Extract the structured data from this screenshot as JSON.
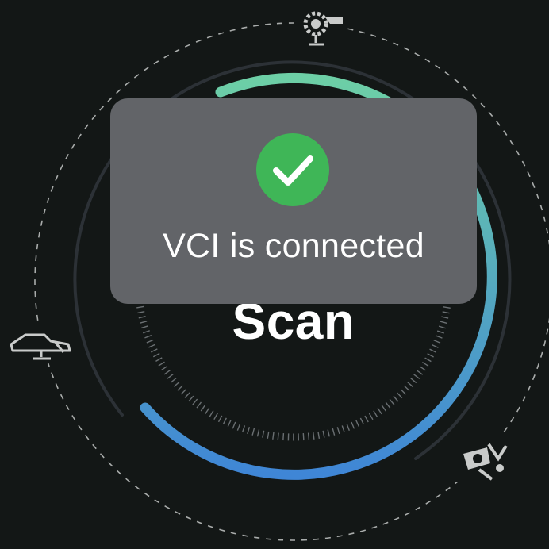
{
  "screen": {
    "background_color": "#131716"
  },
  "dial": {
    "scan_label": "Scan",
    "progress_gradient_start": "#6dcfa6",
    "progress_gradient_end": "#3f86d6",
    "ring_color": "#2c3136",
    "tick_color": "#6a6f72",
    "orbit_color": "#a9acab",
    "icons": [
      {
        "name": "engine-icon"
      },
      {
        "name": "car-lift-icon"
      },
      {
        "name": "brake-service-icon"
      }
    ]
  },
  "toast": {
    "message": "VCI is connected",
    "icon": "check-circle-icon",
    "icon_color": "#3fb657",
    "background_color": "#626468"
  }
}
